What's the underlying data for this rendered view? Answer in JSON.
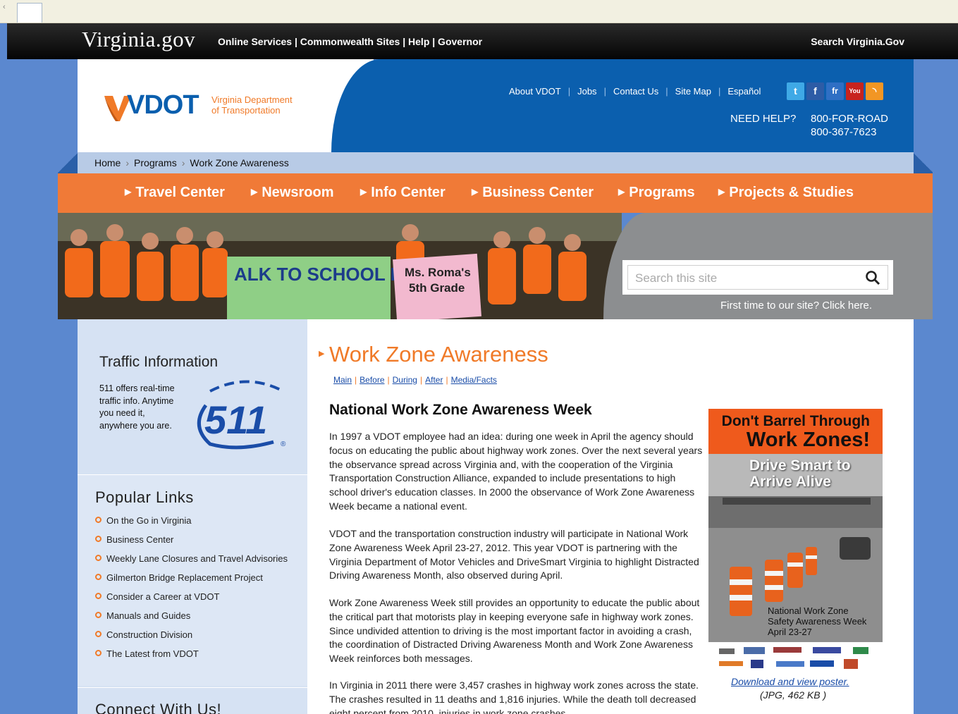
{
  "gov_bar": {
    "logo": "Virginia.gov",
    "links": "Online Services | Commonwealth Sites | Help | Governor",
    "search": "Search Virginia.Gov"
  },
  "header": {
    "logo_name": "VDOT",
    "logo_sub_1": "Virginia Department",
    "logo_sub_2": "of Transportation",
    "top_links": [
      "About VDOT",
      "Jobs",
      "Contact Us",
      "Site Map",
      "Español"
    ],
    "social_icons": [
      "twitter-icon",
      "facebook-icon",
      "flickr-icon",
      "youtube-icon",
      "rss-icon"
    ],
    "need_help": "NEED HELP?",
    "phone_1": "800-FOR-ROAD",
    "phone_2": "800-367-7623"
  },
  "breadcrumb": [
    "Home",
    "Programs",
    "Work Zone Awareness"
  ],
  "nav": [
    "Travel Center",
    "Newsroom",
    "Info Center",
    "Business Center",
    "Programs",
    "Projects & Studies"
  ],
  "hero": {
    "search_placeholder": "Search this site",
    "first_time": "First time to our site? Click here."
  },
  "sidebar": {
    "traffic_title": "Traffic Information",
    "traffic_text": "511 offers real-time traffic info. Anytime you need it, anywhere you are.",
    "logo_511": "511",
    "popular_title": "Popular Links",
    "popular_links": [
      "On the Go in Virginia",
      "Business Center",
      "Weekly Lane Closures and Travel Advisories",
      "Gilmerton Bridge Replacement Project",
      "Consider a Career at VDOT",
      "Manuals and Guides",
      "Construction Division",
      "The Latest from VDOT"
    ],
    "connect_title": "Connect With Us!"
  },
  "main": {
    "title": "Work Zone Awareness",
    "subnav": [
      "Main",
      "Before",
      "During",
      "After",
      "Media/Facts"
    ],
    "section_title": "National Work Zone Awareness Week",
    "paragraphs": [
      "In 1997 a VDOT employee had an idea: during one week in April the agency should focus on educating the public about highway work zones. Over the next several years the observance spread across Virginia and, with the cooperation of the Virginia Transportation Construction Alliance, expanded to include presentations to high school driver's education classes. In 2000 the observance of Work Zone Awareness Week became a national event.",
      "VDOT and the transportation construction industry will participate in National Work Zone Awareness Week April 23-27, 2012. This year VDOT is partnering with the Virginia Department of Motor Vehicles and DriveSmart Virginia to highlight Distracted Driving Awareness Month, also observed during April.",
      "Work Zone Awareness Week still provides an opportunity to educate the public about the critical part that motorists play in keeping everyone safe in highway work zones. Since undivided attention to driving is the most important factor in avoiding a crash, the coordination of Distracted Driving Awareness Month and Work Zone Awareness Week reinforces both messages.",
      "In Virginia in 2011 there were 3,457 crashes in highway work zones across the state. The crashes resulted in 11 deaths and 1,816 injuries. While the death toll decreased eight percent from 2010, injuries in work zone crashes"
    ],
    "poster": {
      "headline_1": "Don't Barrel Through",
      "headline_2": "Work Zones!",
      "tagline_1": "Drive Smart to",
      "tagline_2": "Arrive Alive",
      "footer_1": "National Work Zone",
      "footer_2": "Safety Awareness Week",
      "footer_3": "April 23-27",
      "link": "Download and view poster.",
      "meta": "(JPG, 462 KB )"
    }
  },
  "colors": {
    "vdot_blue": "#0b5fae",
    "vdot_orange": "#f07a37",
    "page_blue": "#5b88cf",
    "sidebar_blue": "#d6e2f3"
  }
}
